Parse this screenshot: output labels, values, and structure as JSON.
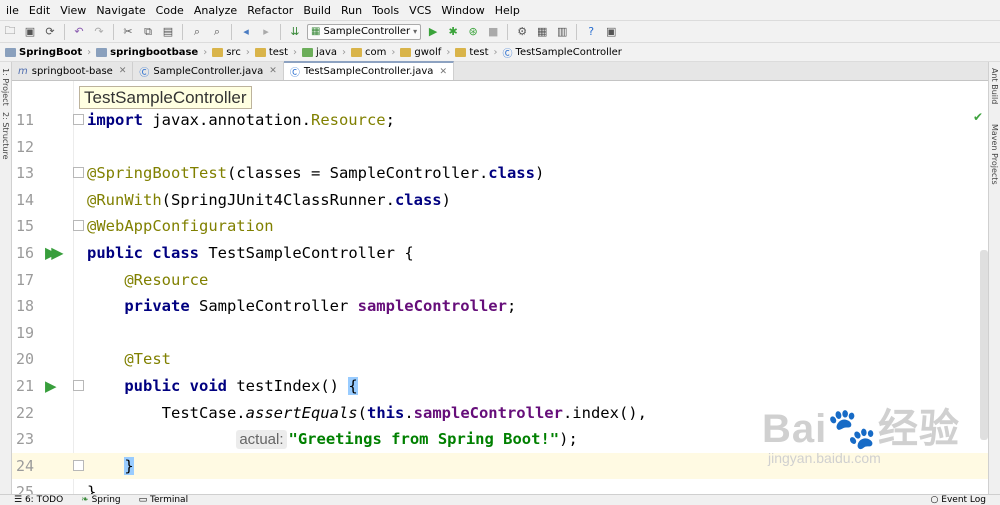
{
  "menu": [
    "ile",
    "Edit",
    "View",
    "Navigate",
    "Code",
    "Analyze",
    "Refactor",
    "Build",
    "Run",
    "Tools",
    "VCS",
    "Window",
    "Help"
  ],
  "toolbar": {
    "run_config": "SampleController"
  },
  "breadcrumbs": [
    "SpringBoot",
    "springbootbase",
    "src",
    "test",
    "java",
    "com",
    "gwolf",
    "test",
    "TestSampleController"
  ],
  "tabs": [
    {
      "label": "springboot-base",
      "prefix": "m"
    },
    {
      "label": "SampleController.java"
    },
    {
      "label": "TestSampleController.java"
    }
  ],
  "left_strip": [
    "1: Project",
    "2: Structure"
  ],
  "right_strip": [
    "Ant Build",
    "Maven Projects"
  ],
  "tooltip": "TestSampleController",
  "lines": {
    "l11": "11",
    "l12": "12",
    "l13": "13",
    "l14": "14",
    "l15": "15",
    "l16": "16",
    "l17": "17",
    "l18": "18",
    "l19": "19",
    "l20": "20",
    "l21": "21",
    "l22": "22",
    "l23": "23",
    "l24": "24",
    "l25": "25"
  },
  "code": {
    "import_kw": "import",
    "import_pkg": " javax.annotation.",
    "import_cls": "Resource",
    "import_end": ";",
    "sbt_ann": "@SpringBootTest",
    "sbt_args": "(classes = SampleController.",
    "class_kw": "class",
    "close_paren": ")",
    "rw_ann": "@RunWith",
    "rw_args": "(SpringJUnit4ClassRunner.",
    "wac_ann": "@WebAppConfiguration",
    "public_kw": "public",
    "cls_decl": " TestSampleController {",
    "res_ann": "@Resource",
    "private_kw": "private",
    "field_type": " SampleController ",
    "field_name": "sampleController",
    "semi": ";",
    "test_ann": "@Test",
    "void_kw": "void",
    "method": " testIndex() ",
    "open_brace": "{",
    "tc": "TestCase.",
    "assert": "assertEquals",
    "paren_open": "(",
    "this_kw": "this",
    "dot": ".",
    "call_rest": ".index(),",
    "hint": "actual:",
    "str": "\"Greetings from Spring Boot!\"",
    "end_call": ");",
    "close_brace": "}",
    "last_brace": "}"
  },
  "status": {
    "todo": "6: TODO",
    "spring": "Spring",
    "terminal": "Terminal",
    "event_log": "Event Log"
  },
  "watermark": {
    "brand": "Bai🐾经验",
    "url": "jingyan.baidu.com"
  }
}
